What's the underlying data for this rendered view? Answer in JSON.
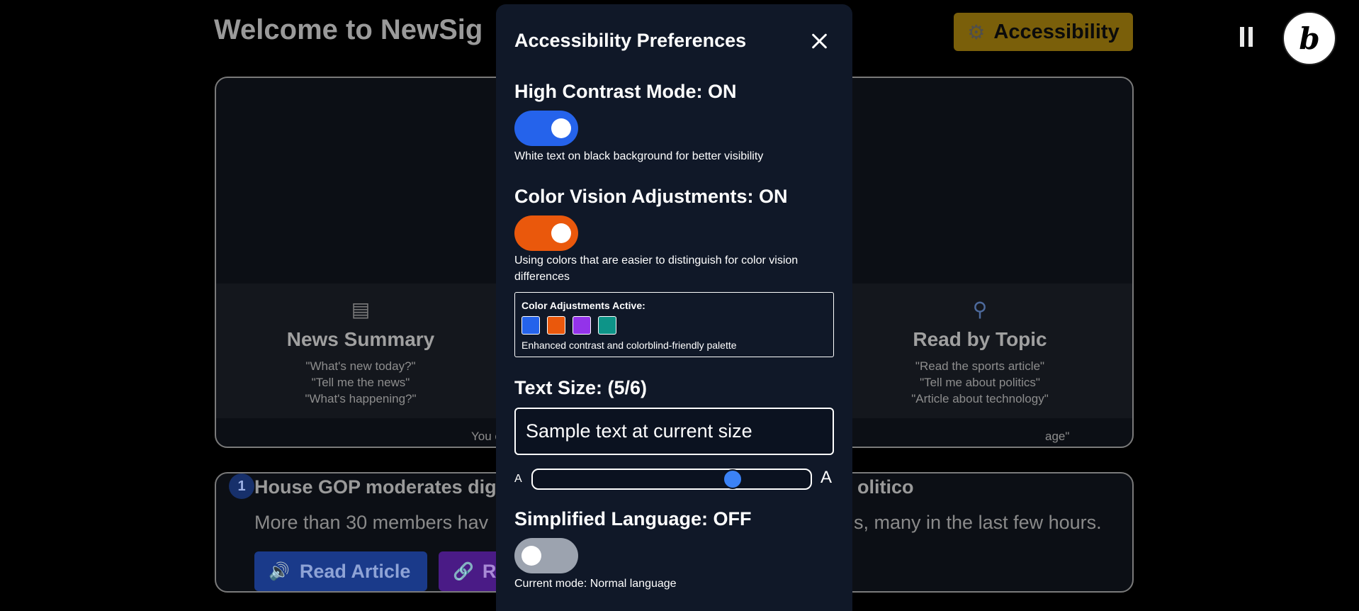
{
  "page": {
    "title": "Welcome to NewSig",
    "accessibility_button": "Accessibility"
  },
  "hero": {
    "features": [
      {
        "title": "News Summary",
        "lines": [
          "\"What's new today?\"",
          "\"Tell me the news\"",
          "\"What's happening?\""
        ]
      },
      {
        "title": "Read by Topic",
        "lines": [
          "\"Read the sports article\"",
          "\"Tell me about politics\"",
          "\"Article about technology\""
        ]
      }
    ],
    "hint_start": "You c",
    "hint_end": "age\""
  },
  "article": {
    "number": "1",
    "title_start": "House GOP moderates dig",
    "title_end": "olitico",
    "summary_start": "More than 30 members hav",
    "summary_end": "s, many in the last few hours.",
    "read_button": "Read Article",
    "link_button": "R"
  },
  "modal": {
    "title": "Accessibility Preferences",
    "high_contrast": {
      "title": "High Contrast Mode: ON",
      "description": "White text on black background for better visibility",
      "on": true
    },
    "color_vision": {
      "title": "Color Vision Adjustments: ON",
      "description": "Using colors that are easier to distinguish for color vision differences",
      "on": true,
      "box_label": "Color Adjustments Active:",
      "box_note": "Enhanced contrast and colorblind-friendly palette",
      "swatches": [
        "#2563eb",
        "#ea580c",
        "#9333ea",
        "#0d9488"
      ]
    },
    "text_size": {
      "title": "Text Size: (5/6)",
      "sample": "Sample text at current size",
      "level": 5,
      "max": 6,
      "small_label": "A",
      "large_label": "A"
    },
    "simplified_language": {
      "title": "Simplified Language: OFF",
      "description": "Current mode: Normal language",
      "on": false
    }
  },
  "colors": {
    "high_contrast_toggle": "#2563eb",
    "color_vision_toggle": "#ea580c",
    "simplified_toggle": "#9ca3af",
    "slider_thumb": "#3b82f6"
  },
  "icons": {
    "accessibility": "gear-icon",
    "pause": "pause-icon",
    "close": "close-icon",
    "news_summary": "newspaper-icon",
    "read_by_topic": "magnifier-icon",
    "read_article": "speaker-icon",
    "link": "link-icon"
  }
}
